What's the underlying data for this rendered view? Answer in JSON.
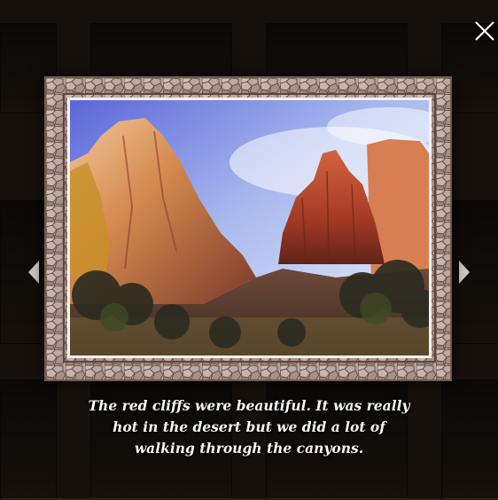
{
  "lightbox": {
    "caption": "The red cliffs were beautiful. It was really hot in the desert but we did a lot of walking through the canyons.",
    "image_subject": "red sandstone canyon cliffs under blue sky",
    "controls": {
      "close_icon": "close-x-icon",
      "prev_icon": "chevron-left-icon",
      "next_icon": "chevron-right-icon"
    }
  },
  "colors": {
    "frame": "#b69f9a",
    "overlay": "rgba(0,0,0,0.62)",
    "caption_text": "#fbf6f0",
    "arrow": "#cfc9c4"
  }
}
